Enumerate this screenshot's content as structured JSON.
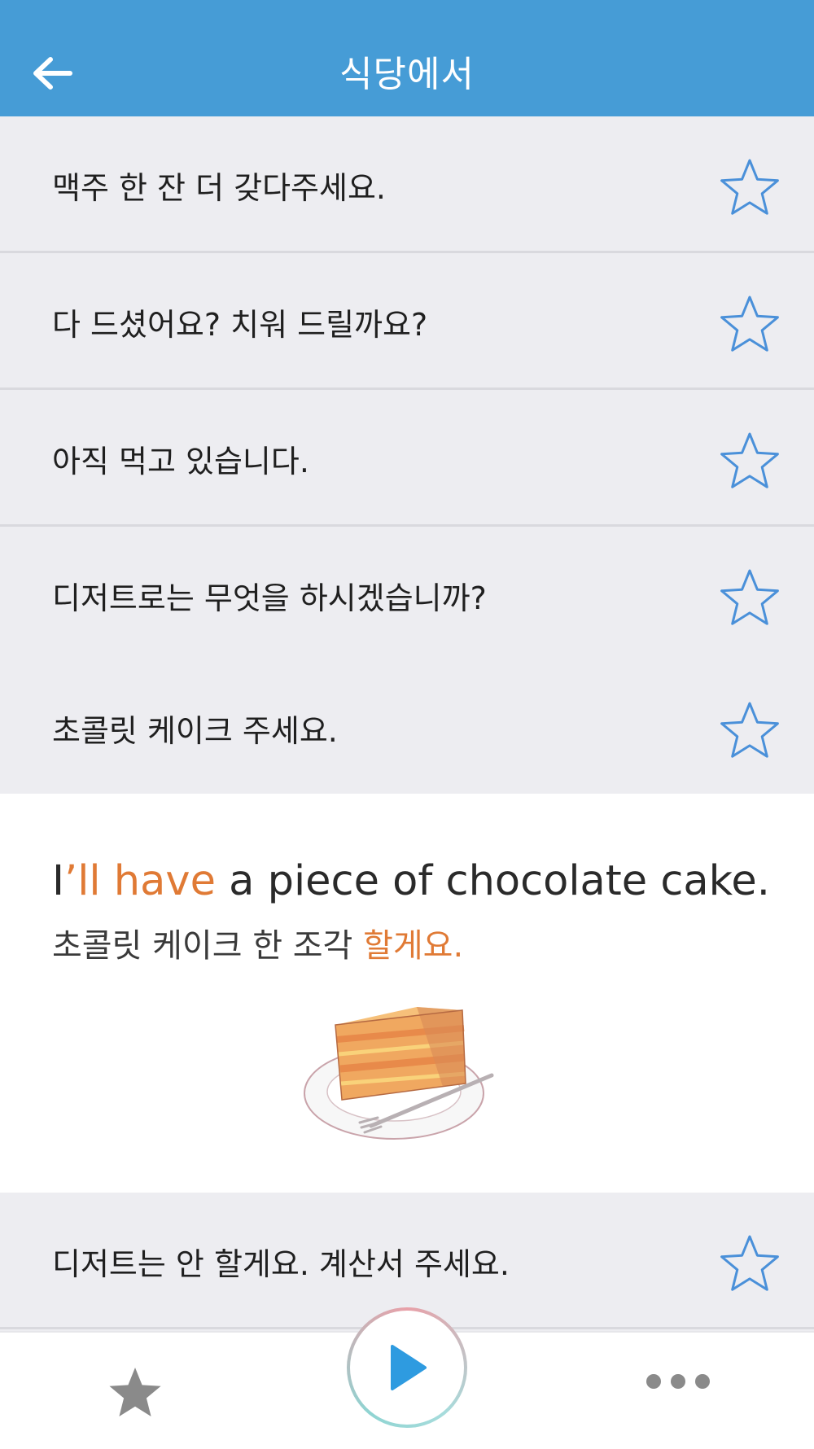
{
  "header": {
    "title": "식당에서",
    "back_icon": "arrow-left-icon"
  },
  "phrases": [
    {
      "ko": "맥주 한 잔 더 갖다주세요."
    },
    {
      "ko": "다 드셨어요? 치워 드릴까요?"
    },
    {
      "ko": "아직 먹고 있습니다."
    },
    {
      "ko": "디저트로는 무엇을 하시겠습니까?"
    },
    {
      "ko": "초콜릿 케이크 주세요."
    },
    {
      "ko": "디저트는 안 할게요. 계산서 주세요."
    }
  ],
  "expanded": {
    "en_prefix": "I",
    "en_highlight": "’ll have",
    "en_rest": " a piece of chocolate cake.",
    "ko_rest": "초콜릿 케이크 한 조각 ",
    "ko_highlight": "할게요.",
    "illustration": "chocolate-cake-slice"
  },
  "bottom_bar": {
    "favorites_icon": "star-filled-icon",
    "play_icon": "play-icon",
    "more_icon": "more-dots-icon"
  },
  "colors": {
    "header": "#469cd6",
    "highlight": "#e07a35",
    "star": "#4a90d9",
    "row_bg": "#ededf1"
  }
}
